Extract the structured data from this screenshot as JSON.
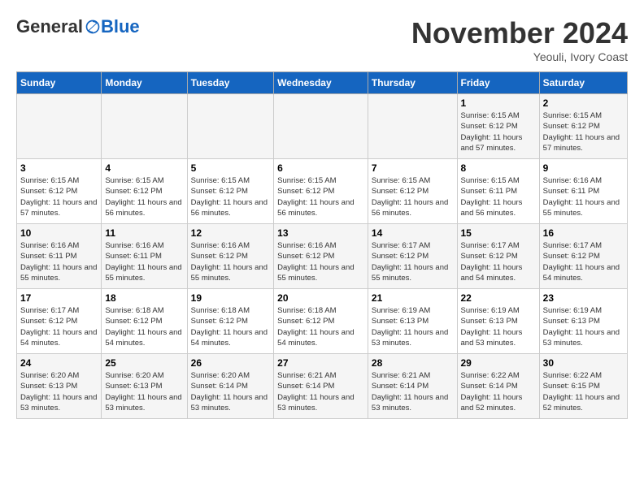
{
  "logo": {
    "general": "General",
    "blue": "Blue"
  },
  "header": {
    "month": "November 2024",
    "location": "Yeouli, Ivory Coast"
  },
  "weekdays": [
    "Sunday",
    "Monday",
    "Tuesday",
    "Wednesday",
    "Thursday",
    "Friday",
    "Saturday"
  ],
  "weeks": [
    [
      {
        "day": "",
        "info": ""
      },
      {
        "day": "",
        "info": ""
      },
      {
        "day": "",
        "info": ""
      },
      {
        "day": "",
        "info": ""
      },
      {
        "day": "",
        "info": ""
      },
      {
        "day": "1",
        "info": "Sunrise: 6:15 AM\nSunset: 6:12 PM\nDaylight: 11 hours and 57 minutes."
      },
      {
        "day": "2",
        "info": "Sunrise: 6:15 AM\nSunset: 6:12 PM\nDaylight: 11 hours and 57 minutes."
      }
    ],
    [
      {
        "day": "3",
        "info": "Sunrise: 6:15 AM\nSunset: 6:12 PM\nDaylight: 11 hours and 57 minutes."
      },
      {
        "day": "4",
        "info": "Sunrise: 6:15 AM\nSunset: 6:12 PM\nDaylight: 11 hours and 56 minutes."
      },
      {
        "day": "5",
        "info": "Sunrise: 6:15 AM\nSunset: 6:12 PM\nDaylight: 11 hours and 56 minutes."
      },
      {
        "day": "6",
        "info": "Sunrise: 6:15 AM\nSunset: 6:12 PM\nDaylight: 11 hours and 56 minutes."
      },
      {
        "day": "7",
        "info": "Sunrise: 6:15 AM\nSunset: 6:12 PM\nDaylight: 11 hours and 56 minutes."
      },
      {
        "day": "8",
        "info": "Sunrise: 6:15 AM\nSunset: 6:11 PM\nDaylight: 11 hours and 56 minutes."
      },
      {
        "day": "9",
        "info": "Sunrise: 6:16 AM\nSunset: 6:11 PM\nDaylight: 11 hours and 55 minutes."
      }
    ],
    [
      {
        "day": "10",
        "info": "Sunrise: 6:16 AM\nSunset: 6:11 PM\nDaylight: 11 hours and 55 minutes."
      },
      {
        "day": "11",
        "info": "Sunrise: 6:16 AM\nSunset: 6:11 PM\nDaylight: 11 hours and 55 minutes."
      },
      {
        "day": "12",
        "info": "Sunrise: 6:16 AM\nSunset: 6:12 PM\nDaylight: 11 hours and 55 minutes."
      },
      {
        "day": "13",
        "info": "Sunrise: 6:16 AM\nSunset: 6:12 PM\nDaylight: 11 hours and 55 minutes."
      },
      {
        "day": "14",
        "info": "Sunrise: 6:17 AM\nSunset: 6:12 PM\nDaylight: 11 hours and 55 minutes."
      },
      {
        "day": "15",
        "info": "Sunrise: 6:17 AM\nSunset: 6:12 PM\nDaylight: 11 hours and 54 minutes."
      },
      {
        "day": "16",
        "info": "Sunrise: 6:17 AM\nSunset: 6:12 PM\nDaylight: 11 hours and 54 minutes."
      }
    ],
    [
      {
        "day": "17",
        "info": "Sunrise: 6:17 AM\nSunset: 6:12 PM\nDaylight: 11 hours and 54 minutes."
      },
      {
        "day": "18",
        "info": "Sunrise: 6:18 AM\nSunset: 6:12 PM\nDaylight: 11 hours and 54 minutes."
      },
      {
        "day": "19",
        "info": "Sunrise: 6:18 AM\nSunset: 6:12 PM\nDaylight: 11 hours and 54 minutes."
      },
      {
        "day": "20",
        "info": "Sunrise: 6:18 AM\nSunset: 6:12 PM\nDaylight: 11 hours and 54 minutes."
      },
      {
        "day": "21",
        "info": "Sunrise: 6:19 AM\nSunset: 6:13 PM\nDaylight: 11 hours and 53 minutes."
      },
      {
        "day": "22",
        "info": "Sunrise: 6:19 AM\nSunset: 6:13 PM\nDaylight: 11 hours and 53 minutes."
      },
      {
        "day": "23",
        "info": "Sunrise: 6:19 AM\nSunset: 6:13 PM\nDaylight: 11 hours and 53 minutes."
      }
    ],
    [
      {
        "day": "24",
        "info": "Sunrise: 6:20 AM\nSunset: 6:13 PM\nDaylight: 11 hours and 53 minutes."
      },
      {
        "day": "25",
        "info": "Sunrise: 6:20 AM\nSunset: 6:13 PM\nDaylight: 11 hours and 53 minutes."
      },
      {
        "day": "26",
        "info": "Sunrise: 6:20 AM\nSunset: 6:14 PM\nDaylight: 11 hours and 53 minutes."
      },
      {
        "day": "27",
        "info": "Sunrise: 6:21 AM\nSunset: 6:14 PM\nDaylight: 11 hours and 53 minutes."
      },
      {
        "day": "28",
        "info": "Sunrise: 6:21 AM\nSunset: 6:14 PM\nDaylight: 11 hours and 53 minutes."
      },
      {
        "day": "29",
        "info": "Sunrise: 6:22 AM\nSunset: 6:14 PM\nDaylight: 11 hours and 52 minutes."
      },
      {
        "day": "30",
        "info": "Sunrise: 6:22 AM\nSunset: 6:15 PM\nDaylight: 11 hours and 52 minutes."
      }
    ]
  ]
}
